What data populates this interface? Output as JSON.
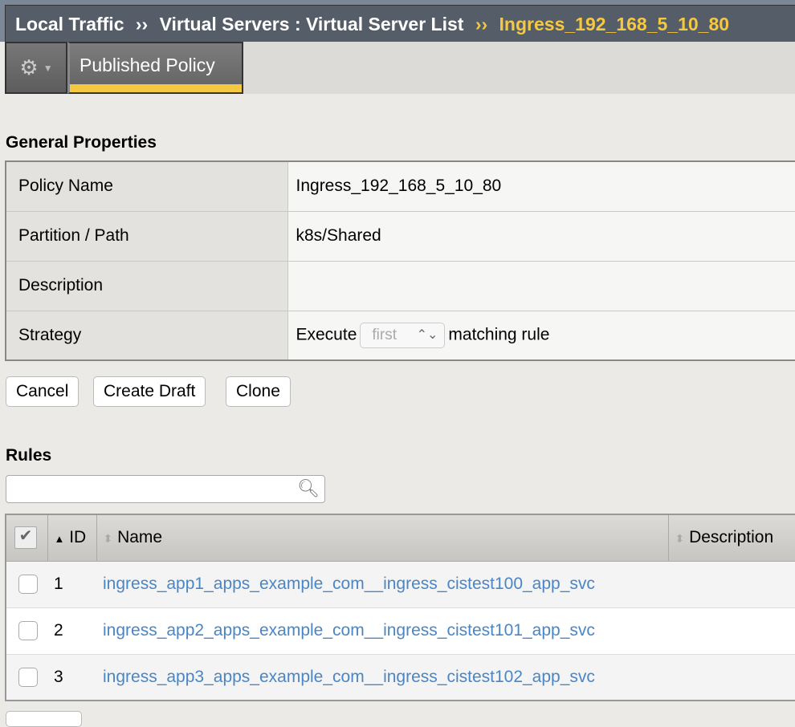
{
  "breadcrumb": {
    "items": [
      "Local Traffic",
      "Virtual Servers : Virtual Server List"
    ],
    "separator": "››",
    "current": "Ingress_192_168_5_10_80"
  },
  "tabs": {
    "gear_icon": "gear-icon",
    "active": "Published Policy"
  },
  "general": {
    "title": "General Properties",
    "rows": [
      {
        "label": "Policy Name",
        "value": "Ingress_192_168_5_10_80"
      },
      {
        "label": "Partition / Path",
        "value": "k8s/Shared"
      },
      {
        "label": "Description",
        "value": ""
      }
    ],
    "strategy": {
      "label": "Strategy",
      "prefix": "Execute",
      "select": "first",
      "suffix": "matching rule"
    }
  },
  "buttons": {
    "cancel": "Cancel",
    "create_draft": "Create Draft",
    "clone": "Clone"
  },
  "rules": {
    "title": "Rules",
    "search_placeholder": "",
    "columns": {
      "id": "ID",
      "name": "Name",
      "description": "Description"
    },
    "rows": [
      {
        "id": "1",
        "name": "ingress_app1_apps_example_com__ingress_cistest100_app_svc"
      },
      {
        "id": "2",
        "name": "ingress_app2_apps_example_com__ingress_cistest101_app_svc"
      },
      {
        "id": "3",
        "name": "ingress_app3_apps_example_com__ingress_cistest102_app_svc"
      }
    ]
  },
  "colors": {
    "accent": "#f5c842",
    "link": "#4a86c5",
    "header": "#555d68"
  }
}
